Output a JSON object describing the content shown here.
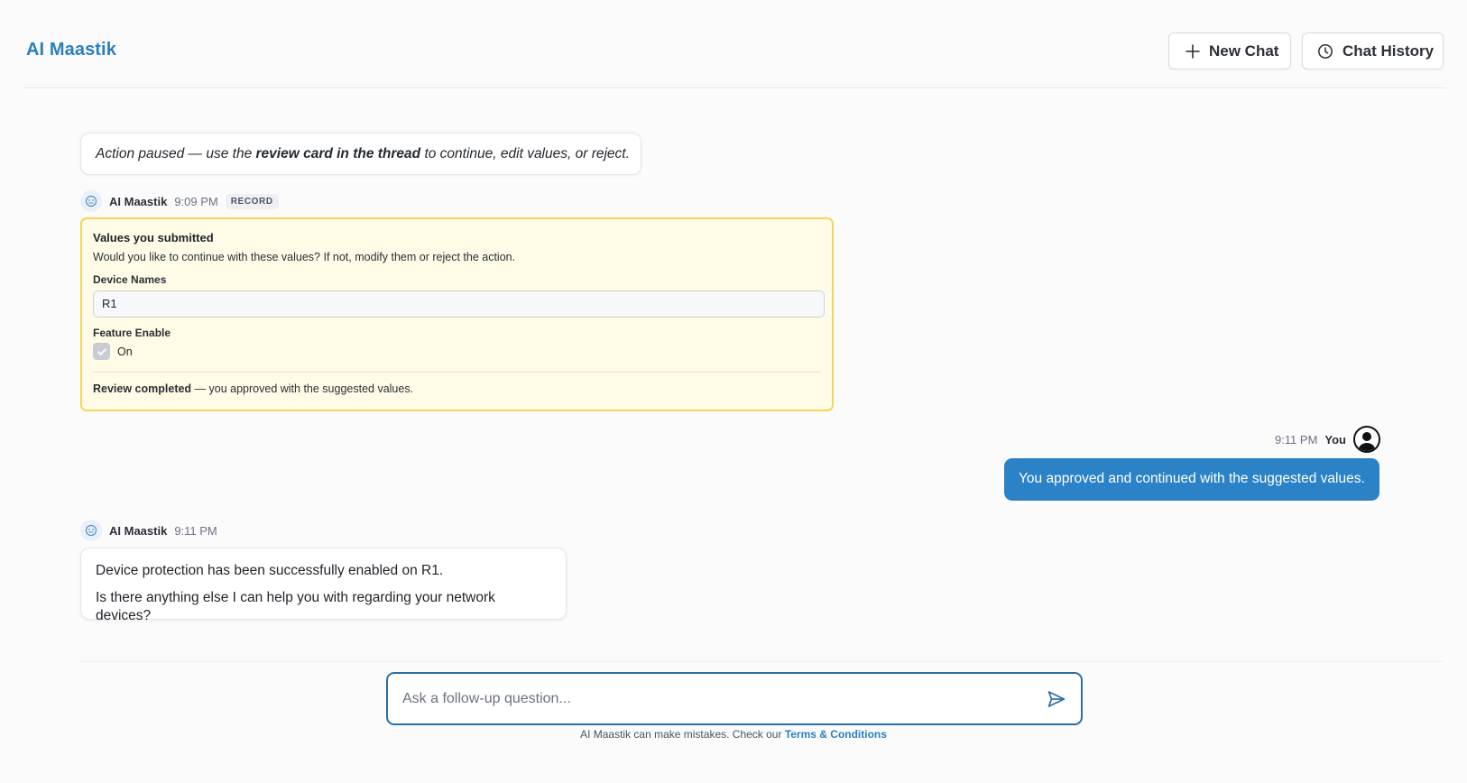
{
  "app": {
    "title": "AI Maastik"
  },
  "header": {
    "new_chat": "New Chat",
    "chat_history": "Chat History"
  },
  "paused_note": {
    "prefix": "Action paused — use the ",
    "emphasis": "review card in the thread",
    "suffix": " to continue, edit values, or reject."
  },
  "messages": [
    {
      "sender": "AI Maastik",
      "time": "9:09 PM",
      "tag": "RECORD"
    },
    {
      "sender": "You",
      "time": "9:11 PM",
      "text": "You approved and continued with the suggested values."
    },
    {
      "sender": "AI Maastik",
      "time": "9:11 PM",
      "lines": [
        "Device protection has been successfully enabled on R1.",
        "Is there anything else I can help you with regarding your network devices?"
      ]
    }
  ],
  "review_card": {
    "title": "Values you submitted",
    "description": "Would you like to continue with these values? If not, modify them or reject the action.",
    "device_names_label": "Device Names",
    "device_names_value": "R1",
    "feature_label": "Feature Enable",
    "feature_value": "On",
    "feature_checked": true,
    "status_bold": "Review completed",
    "status_rest": " — you approved with the suggested values."
  },
  "composer": {
    "placeholder": "Ask a follow-up question...",
    "disclaimer": "AI Maastik can make mistakes. Check our ",
    "terms_link": "Terms & Conditions"
  },
  "colors": {
    "brand": "#2a7fbf",
    "user_bubble": "#2b82c6",
    "review_bg": "#fffbe6",
    "review_border": "#f5d55a"
  },
  "icons": [
    "plus-icon",
    "clock-icon",
    "bot-icon",
    "user-icon",
    "check-icon",
    "send-icon"
  ]
}
